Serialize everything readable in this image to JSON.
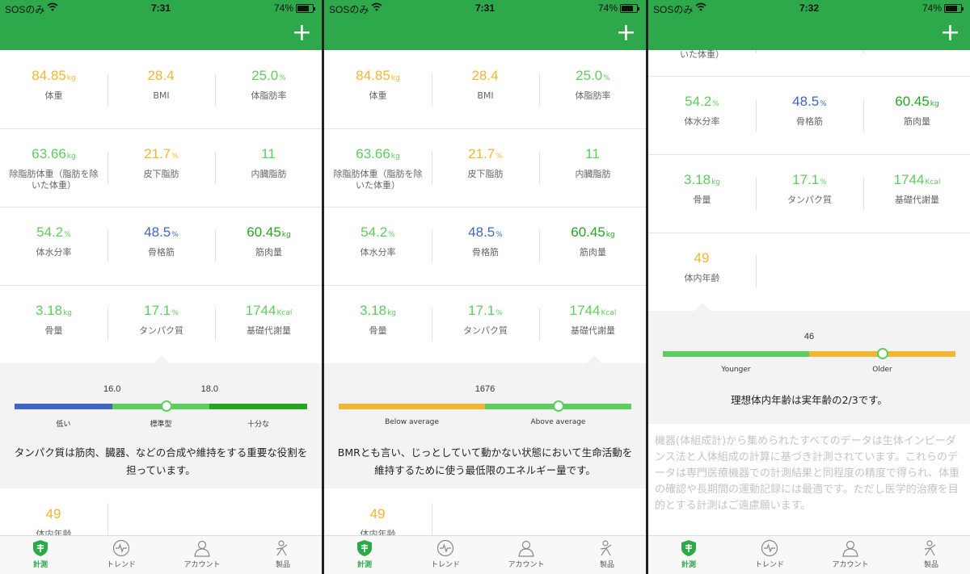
{
  "colors": {
    "green": "#2da84b",
    "orange": "#f2b632",
    "light_green": "#5cce5c",
    "blue": "#3d67c2",
    "dark_green": "#26a521"
  },
  "statusbar": {
    "carrier": "SOSのみ",
    "battery": "74%",
    "times": [
      "7:31",
      "7:31",
      "7:32"
    ]
  },
  "metrics": {
    "weight": {
      "value": "84.85",
      "unit": "kg",
      "label": "体重"
    },
    "bmi": {
      "value": "28.4",
      "unit": "",
      "label": "BMI"
    },
    "body_fat": {
      "value": "25.0",
      "unit": "%",
      "label": "体脂肪率"
    },
    "fat_free": {
      "value": "63.66",
      "unit": "kg",
      "label": "除脂肪体重（脂肪を除いた体重）"
    },
    "subcutaneous": {
      "value": "21.7",
      "unit": "%",
      "label": "皮下脂肪"
    },
    "visceral": {
      "value": "11",
      "unit": "",
      "label": "内臓脂肪"
    },
    "water": {
      "value": "54.2",
      "unit": "%",
      "label": "体水分率"
    },
    "skeletal": {
      "value": "48.5",
      "unit": "%",
      "label": "骨格筋"
    },
    "muscle": {
      "value": "60.45",
      "unit": "kg",
      "label": "筋肉量"
    },
    "bone": {
      "value": "3.18",
      "unit": "kg",
      "label": "骨量"
    },
    "protein": {
      "value": "17.1",
      "unit": "%",
      "label": "タンパク質"
    },
    "bmr": {
      "value": "1744",
      "unit": "Kcal",
      "label": "基礎代謝量"
    },
    "body_age": {
      "value": "49",
      "unit": "",
      "label": "体内年齢"
    }
  },
  "protein_panel": {
    "ticks": [
      "16.0",
      "18.0"
    ],
    "segments": [
      "低い",
      "標準型",
      "十分な"
    ],
    "marker_fraction": 0.52,
    "description": "タンパク質は筋肉、臓器、などの合成や維持をする重要な役割を担っています。"
  },
  "bmr_panel": {
    "ticks": [
      "1676"
    ],
    "segments": [
      "Below average",
      "Above average"
    ],
    "marker_fraction": 0.75,
    "description": "BMRとも言い、じっとしていて動かない状態において生命活動を維持するために使う最低限のエネルギー量です。"
  },
  "age_panel": {
    "ticks": [
      "46"
    ],
    "segments": [
      "Younger",
      "Older"
    ],
    "marker_fraction": 0.75,
    "description": "理想体内年齢は実年齢の2/3です。"
  },
  "disclaimer": "機器(体組成計)から集められたすべてのデータは生体インピーダンス法と人体組成の計算に基づき計測されています。これらのデータは専門医療機器での計測結果と同程度の精度で得られ、体重の確認や長期間の運動記録には最適です。ただし医学的治療を目的とする計測はご遠慮願います。",
  "tabs": [
    {
      "label": "計測",
      "icon": "shield-icon"
    },
    {
      "label": "トレンド",
      "icon": "pulse-icon"
    },
    {
      "label": "アカウント",
      "icon": "person-icon"
    },
    {
      "label": "製品",
      "icon": "product-icon"
    }
  ]
}
